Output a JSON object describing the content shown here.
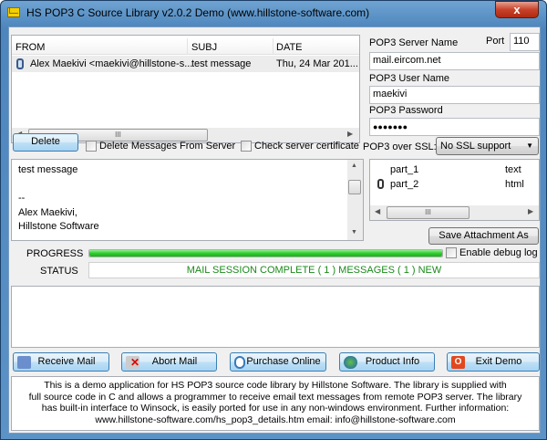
{
  "window": {
    "title": "HS POP3 C Source Library v2.0.2  Demo (www.hillstone-software.com)",
    "close": "x"
  },
  "messages": {
    "columns": [
      "FROM",
      "SUBJ",
      "DATE"
    ],
    "rows": [
      {
        "from": "Alex Maekivi <maekivi@hillstone-s...",
        "subj": "test message",
        "date": "Thu, 24 Mar 201..."
      }
    ],
    "scroll_grip": "III"
  },
  "server": {
    "server_label": "POP3 Server Name",
    "port_label": "Port",
    "port": "110",
    "server": "mail.eircom.net",
    "user_label": "POP3 User Name",
    "user": "maekivi",
    "password_label": "POP3 Password",
    "password": "●●●●●●●"
  },
  "controls": {
    "delete": "Delete",
    "delete_from_server": "Delete Messages From Server",
    "check_cert": "Check server certificate",
    "ssl_label": "POP3 over SSL:",
    "ssl_value": "No SSL support"
  },
  "body": {
    "lines": [
      "test message",
      "",
      "--",
      "Alex Maekivi,",
      "Hillstone Software"
    ]
  },
  "attachments": {
    "items": [
      {
        "name": "part_1",
        "type": "text"
      },
      {
        "name": "part_2",
        "type": "html"
      }
    ],
    "scroll_grip": "III",
    "save": "Save Attachment As"
  },
  "progress": {
    "label": "PROGRESS",
    "percent": 100,
    "debug": "Enable debug log",
    "color": "#2ecc2e"
  },
  "status": {
    "label": "STATUS",
    "text": "MAIL SESSION COMPLETE ( 1 ) MESSAGES ( 1 ) NEW",
    "color": "#1a8a1a"
  },
  "buttons": {
    "receive": "Receive Mail",
    "abort": "Abort Mail",
    "purchase": "Purchase Online",
    "info": "Product Info",
    "exit": "Exit Demo"
  },
  "footer": {
    "lines": [
      "This is a demo application for HS POP3 source code library by Hillstone Software. The library is supplied with",
      "full source code in C and allows a programmer to receive email text messages from remote POP3 server. The library",
      "has built-in interface to Winsock, is easily ported for use in any non-windows environment. Further information:",
      "www.hillstone-software.com/hs_pop3_details.htm email: info@hillstone-software.com"
    ]
  }
}
